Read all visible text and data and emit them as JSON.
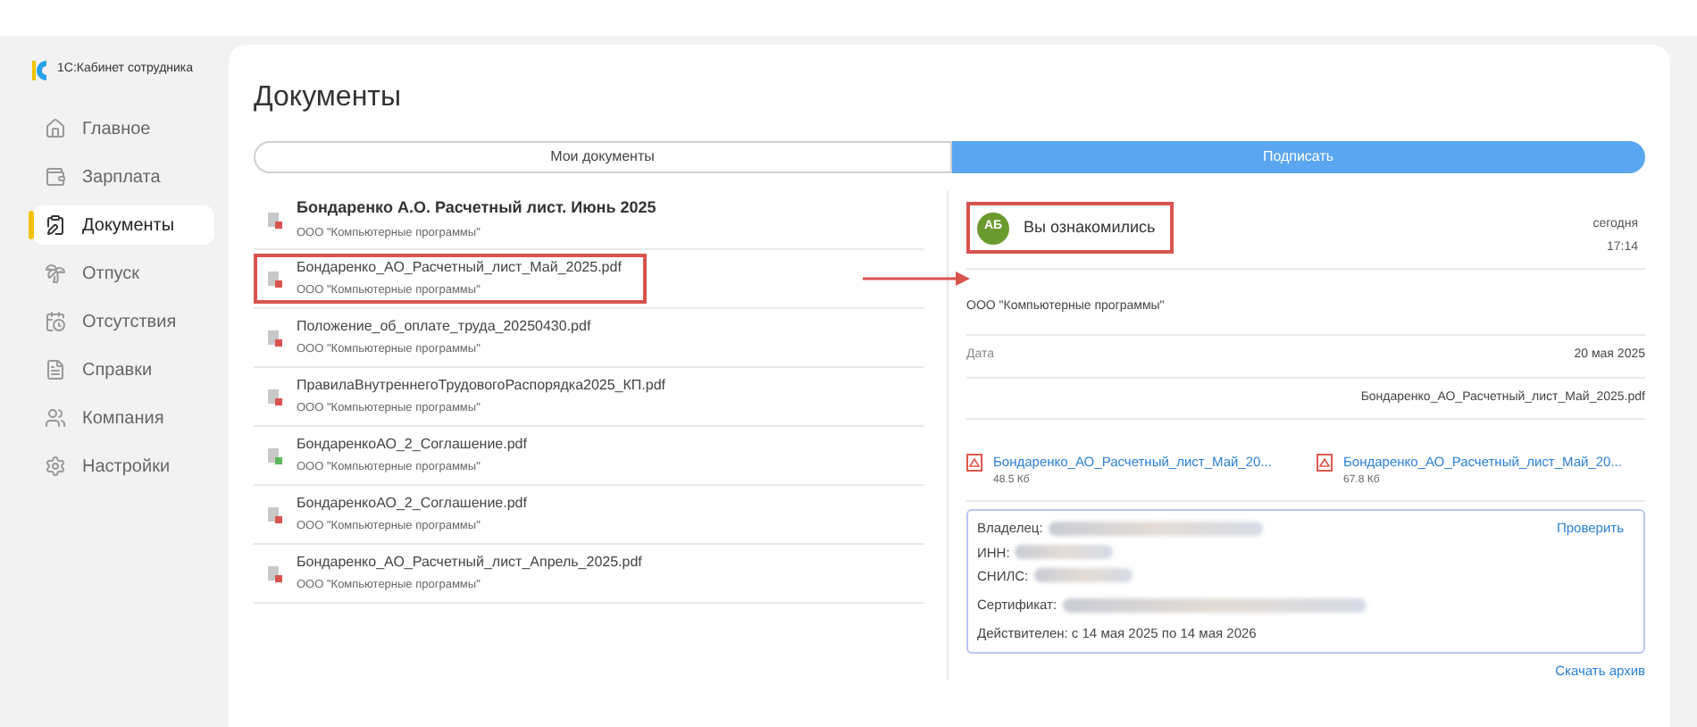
{
  "app": {
    "logo_text": "1С:Кабинет сотрудника"
  },
  "sidebar": {
    "items": [
      {
        "label": "Главное",
        "selected": false
      },
      {
        "label": "Зарплата",
        "selected": false
      },
      {
        "label": "Документы",
        "selected": true
      },
      {
        "label": "Отпуск",
        "selected": false
      },
      {
        "label": "Отсутствия",
        "selected": false
      },
      {
        "label": "Справки",
        "selected": false
      },
      {
        "label": "Компания",
        "selected": false
      },
      {
        "label": "Настройки",
        "selected": false
      }
    ]
  },
  "page": {
    "title": "Документы"
  },
  "tabs": [
    {
      "label": "Мои документы",
      "selected": false
    },
    {
      "label": "Подписать",
      "selected": true
    }
  ],
  "documents": [
    {
      "title": "Бондаренко А.О. Расчетный лист. Июнь 2025",
      "org": "ООО \"Компьютерные программы\"",
      "unread": true,
      "highlighted": false,
      "color": "#d9534f"
    },
    {
      "title": "Бондаренко_АО_Расчетный_лист_Май_2025.pdf",
      "org": "ООО \"Компьютерные программы\"",
      "unread": false,
      "highlighted": true,
      "color": "#d9534f"
    },
    {
      "title": "Положение_об_оплате_труда_20250430.pdf",
      "org": "ООО \"Компьютерные программы\"",
      "unread": false,
      "highlighted": false,
      "color": "#d9534f"
    },
    {
      "title": "ПравилаВнутреннегоТрудовогоРаспорядка2025_КП.pdf",
      "org": "ООО \"Компьютерные программы\"",
      "unread": false,
      "highlighted": false,
      "color": "#d9534f"
    },
    {
      "title": "БондаренкоАО_2_Соглашение.pdf",
      "org": "ООО \"Компьютерные программы\"",
      "unread": false,
      "highlighted": false,
      "color": "#5cb85c"
    },
    {
      "title": "БондаренкоАО_2_Соглашение.pdf",
      "org": "ООО \"Компьютерные программы\"",
      "unread": false,
      "highlighted": false,
      "color": "#d9534f"
    },
    {
      "title": "Бондаренко_АО_Расчетный_лист_Апрель_2025.pdf",
      "org": "ООО \"Компьютерные программы\"",
      "unread": false,
      "highlighted": false,
      "color": "#d9534f"
    }
  ],
  "detail": {
    "status": {
      "initials": "АБ",
      "text": "Вы ознакомились",
      "day": "сегодня",
      "time": "17:14",
      "highlighted": true
    },
    "org": "ООО \"Компьютерные программы\"",
    "date_label": "Дата",
    "date_value": "20 мая 2025",
    "file_name": "Бондаренко_АО_Расчетный_лист_Май_2025.pdf",
    "attachments": [
      {
        "name": "Бондаренко_АО_Расчетный_лист_Май_20...",
        "size": "48.5 Кб"
      },
      {
        "name": "Бондаренко_АО_Расчетный_лист_Май_20...",
        "size": "67.8 Кб"
      }
    ],
    "signature": {
      "owner_label": "Владелец:",
      "inn_label": "ИНН:",
      "snils_label": "СНИЛС:",
      "certificate_label": "Сертификат:",
      "valid": "Действителен: с 14 мая 2025 по 14 мая 2026",
      "verify": "Проверить"
    },
    "download": "Скачать архив"
  }
}
